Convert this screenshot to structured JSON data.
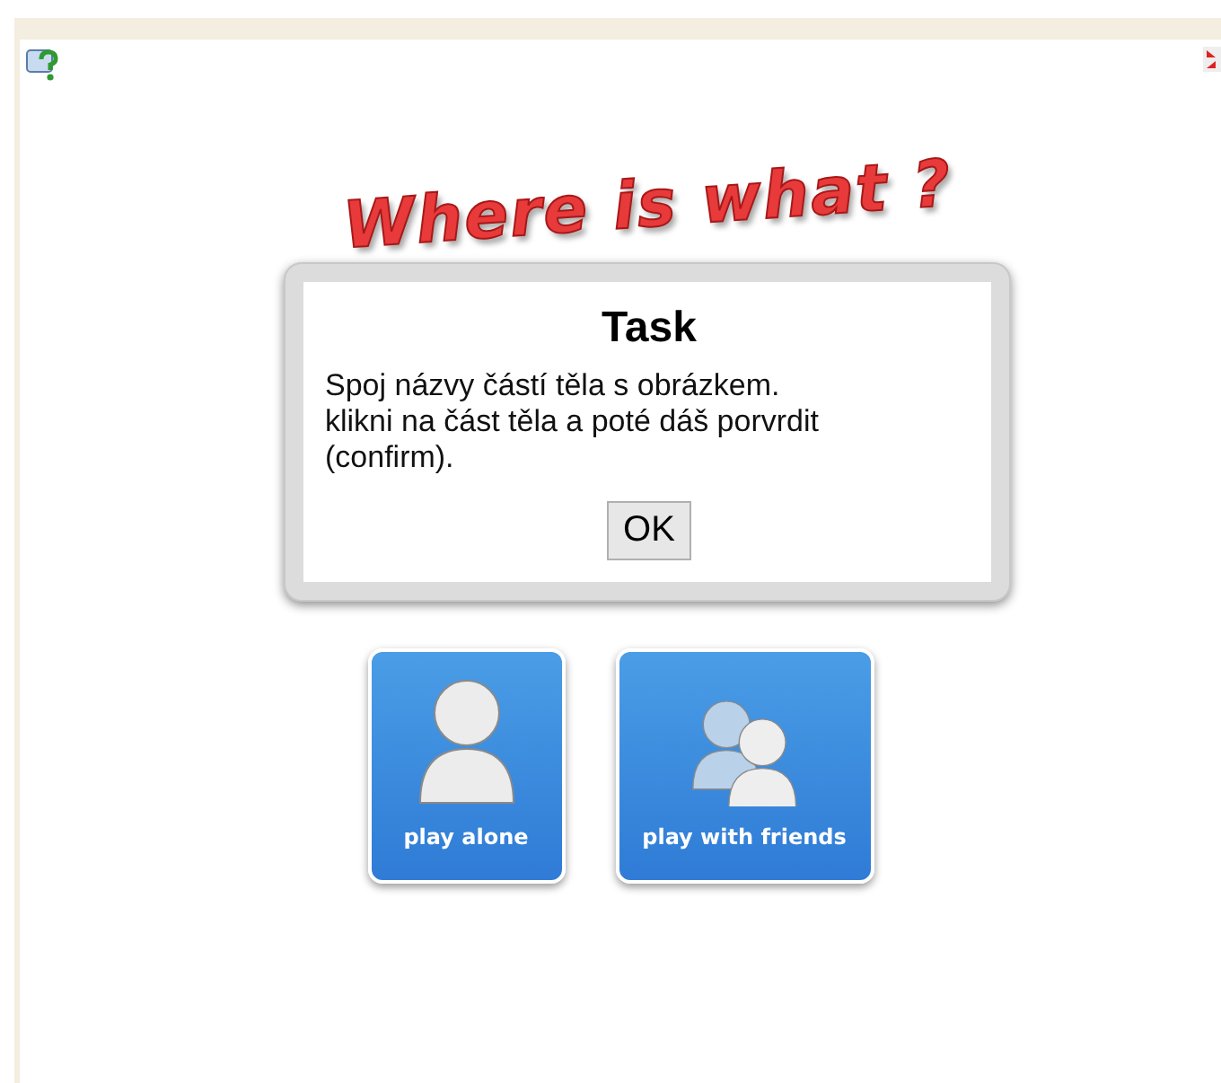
{
  "title": "Where is what ?",
  "dialog": {
    "title": "Task",
    "message": [
      "Spoj názvy částí těla s obrázkem.",
      "klikni na část těla a poté dáš porvrdit (confirm)."
    ],
    "button": "OK"
  },
  "modes": [
    {
      "label": "play alone",
      "kind": "single"
    },
    {
      "label": "play with friends",
      "kind": "group"
    }
  ]
}
